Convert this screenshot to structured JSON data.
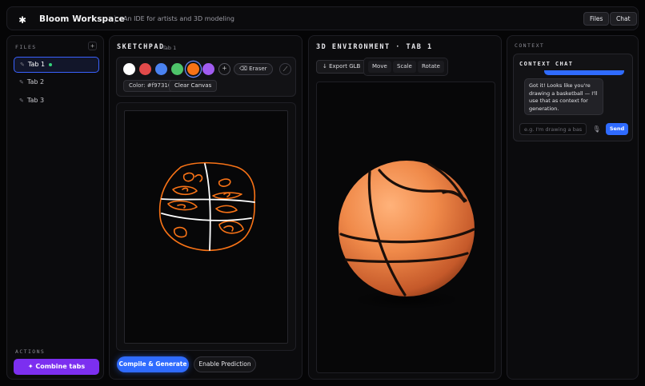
{
  "header": {
    "logo_icon": "asterisk-logo-icon",
    "title": "Bloom Workspace",
    "subtitle": "An IDE for artists and 3D modeling",
    "buttons": {
      "files": "Files",
      "chat": "Chat"
    }
  },
  "files": {
    "label": "FILES",
    "add_icon": "+",
    "items": [
      {
        "label": "Tab 1",
        "active": true
      },
      {
        "label": "Tab 2",
        "active": false
      },
      {
        "label": "Tab 3",
        "active": false
      }
    ],
    "actions_label": "ACTIONS",
    "combine_label": "Combine tabs"
  },
  "sketchpad": {
    "title": "SKETCHPAD",
    "tab": "Tab 1",
    "swatches": [
      "#ffffff",
      "#e24a4a",
      "#4a82f0",
      "#4ec46a",
      "#f97316",
      "#a15cf0"
    ],
    "selected_color": "#f97316",
    "eraser_label": "Eraser",
    "color_label": "Color: #f97316",
    "clear_label": "Clear Canvas",
    "compile_label": "Compile & Generate",
    "predict_label": "Enable Prediction"
  },
  "environment": {
    "title": "3D ENVIRONMENT · TAB 1",
    "export_label": "Export GLB",
    "tools": [
      "Move",
      "Scale",
      "Rotate"
    ]
  },
  "context": {
    "label": "CONTEXT",
    "chat_title": "CONTEXT CHAT",
    "bot_message": "Got it! Looks like you're drawing a basketball — I'll use that as context for generation.",
    "input_placeholder": "e.g. I'm drawing a basketball",
    "send_label": "Send"
  },
  "colors": {
    "accent": "#2f6bff",
    "purple": "#7c2ff0",
    "orange": "#f97316"
  }
}
